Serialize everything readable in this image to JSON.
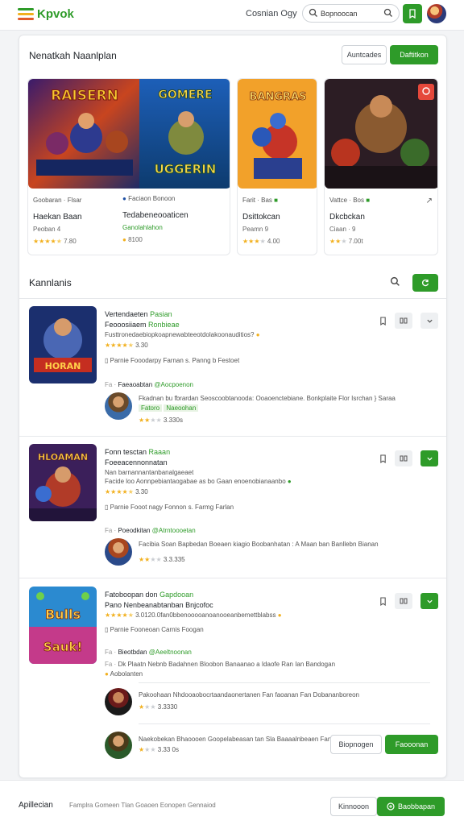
{
  "brand": {
    "name": "Kpvok",
    "accent": "#2e9b29",
    "logo_colors": [
      "#2e9b29",
      "#f2b01e",
      "#e05a2a"
    ]
  },
  "header": {
    "link": "Cosnian Ogy",
    "search_value": "Bopnoocan",
    "icons": [
      "search-icon",
      "search-icon",
      "bookmark-icon"
    ]
  },
  "featured": {
    "title": "Nenatkah Naanlplan",
    "outline_btn": "Auntcades",
    "green_btn": "Daftitkon",
    "cards": [
      {
        "meta": "Goobaran · Flsar",
        "title": "Haekan Baan",
        "sub": "Peoban 4",
        "rating": "7.80",
        "stars": 4.5
      },
      {
        "meta": "Faciaon Bonoon",
        "title": "Tedabeneooaticen",
        "sub": "Ganolahlahon",
        "rating": "8100",
        "stars": 1
      },
      {
        "meta": "Farit · Bas",
        "title": "Dsittokcan",
        "sub": "Peamn 9",
        "rating": "4.00",
        "stars": 3
      },
      {
        "meta": "Vattce · Bos",
        "title": "Dkcbckan",
        "sub": "Ciaan · 9",
        "rating": "7.00t",
        "stars": 2
      }
    ]
  },
  "list": {
    "title": "Kannlanis",
    "items": [
      {
        "title": "Vertendaeten",
        "title_green": "Pasian",
        "line2": "Feooosiiaem",
        "line2_green": "Ronbieae",
        "line3_green": "Fusttronedaebiopkoapnewabteeotdolakoonauditios?",
        "rating": "3.30",
        "note": "Parnie Fooodarpy Farnan s. Panng b Festoet",
        "reply_name": "Faeaoabtan",
        "reply_tag": "@Aocpoenon",
        "reply_text": "Fkadnan bu fbrardan Seoscoobtanooda: Ooaoenctebiane. Bonkplaite Flor Isrchan } Saraa",
        "reply_rating": "3.330s"
      },
      {
        "title": "Fonn tesctan",
        "title_green": "Raaan",
        "line2": "Foeeacennonnatan",
        "line2_green": "Nan barnannantanbanalgaeaet",
        "line3": "Facide loo Aonnpebiantaogabae as bo Gaan enoenobianaanbo",
        "rating": "3.30",
        "note": "Parnie Fooot nagy Fonnon s. Farmg Farlan",
        "reply_name": "Poeodkitan",
        "reply_tag": "@Atrntoooetan",
        "reply_text": "Facibia Soan Bapbedan Boeaen kiagio Boobanhatan : A Maan ban Banllebn Bianan",
        "reply_rating": "3.3.335"
      },
      {
        "title": "Fatoboopan don",
        "title_green": "Gapdooan",
        "line2": "Pano Nenbeanabtanban Bnjcofoc",
        "line3": "3.0120.0fan0bbenooooanoanooeanbemettblabss",
        "rating": "",
        "note": "Parnie Fooneoan Carnis Foogan",
        "reply_name": "Bieotbdan",
        "reply_tag": "@Aeeltnoonan",
        "reply_text": "Dk Plaatn Nebnb Badahnen Bloobon Banaanao a Idaofe Ran Ian Bandogan",
        "reply_text2": "Aobolanten",
        "sub_replies": [
          {
            "text": "Pakoohaan Nhdooaobocrtaandaonertanen Fan faoanan Fan Dobananboreon",
            "rating": "3.3330"
          },
          {
            "text": "Naekobekan Bhaoooen Goopelabeasan tan Sla Baaaalnbeaen Fan",
            "rating": "3.33 0s"
          }
        ],
        "outline_btn": "Biopnogen",
        "green_btn": "Faooonan"
      }
    ]
  },
  "footer": {
    "title": "Apillecian",
    "desc": "Famplra Gomeen Tlan Goaoen Eonopen Gennaiod",
    "outline_btn": "Kinnooon",
    "green_btn": "Baobbapan"
  }
}
